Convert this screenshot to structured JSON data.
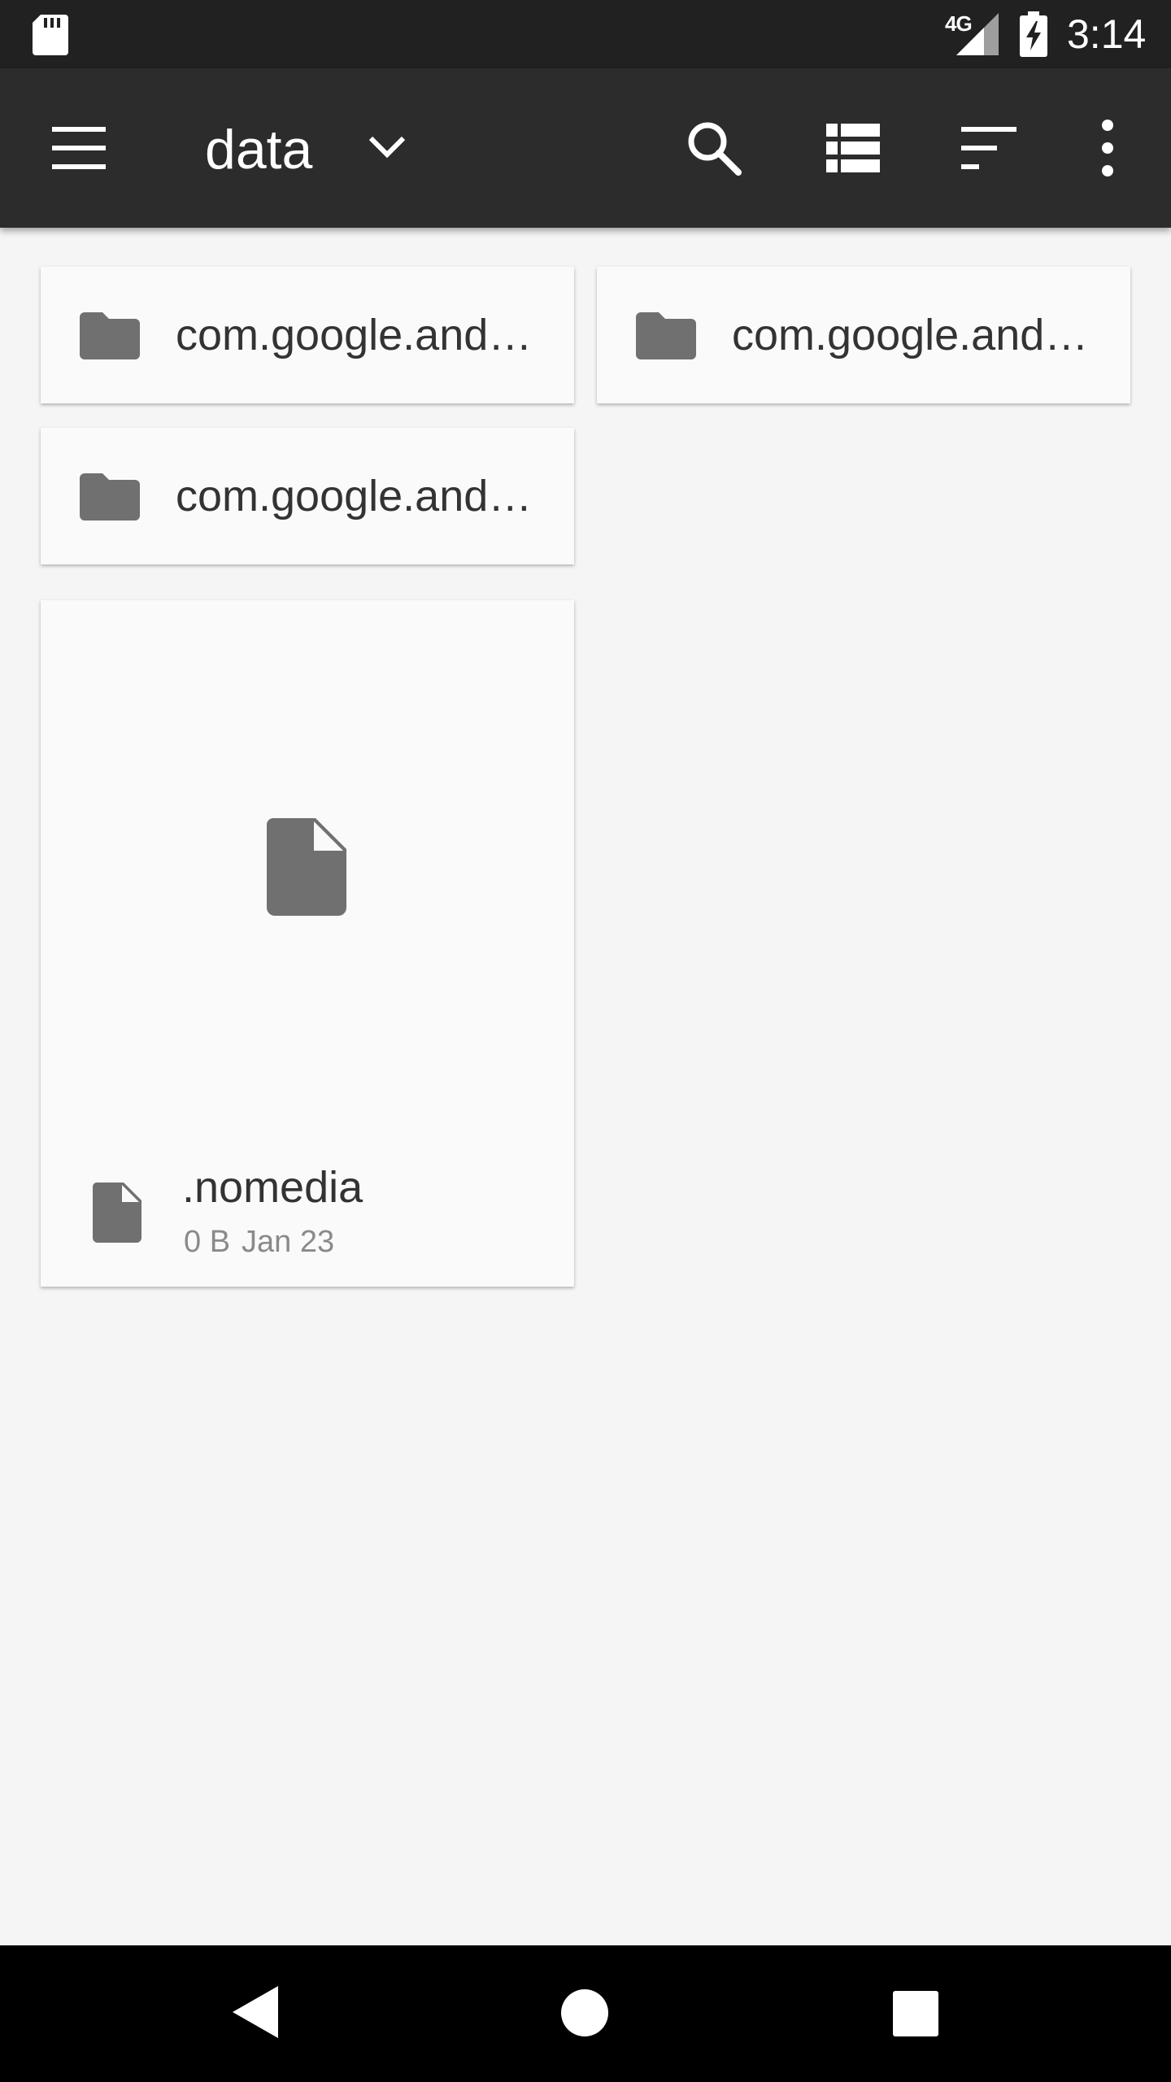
{
  "status_bar": {
    "network": "4G",
    "time": "3:14"
  },
  "app_bar": {
    "title": "data",
    "icons": [
      "menu-icon",
      "chevron-down-icon",
      "search-icon",
      "list-view-icon",
      "sort-icon",
      "more-vert-icon"
    ]
  },
  "folders": [
    {
      "name": "com.google.and…"
    },
    {
      "name": "com.google.and…"
    },
    {
      "name": "com.google.and…"
    }
  ],
  "files": [
    {
      "name": ".nomedia",
      "size": "0 B",
      "date": "Jan 23"
    }
  ],
  "colors": {
    "status_bar": "#212121",
    "app_bar": "#2c2c2c",
    "background": "#f5f5f5",
    "card": "#fafafa",
    "icon_gray": "#707070",
    "nav_bar": "#000000"
  }
}
